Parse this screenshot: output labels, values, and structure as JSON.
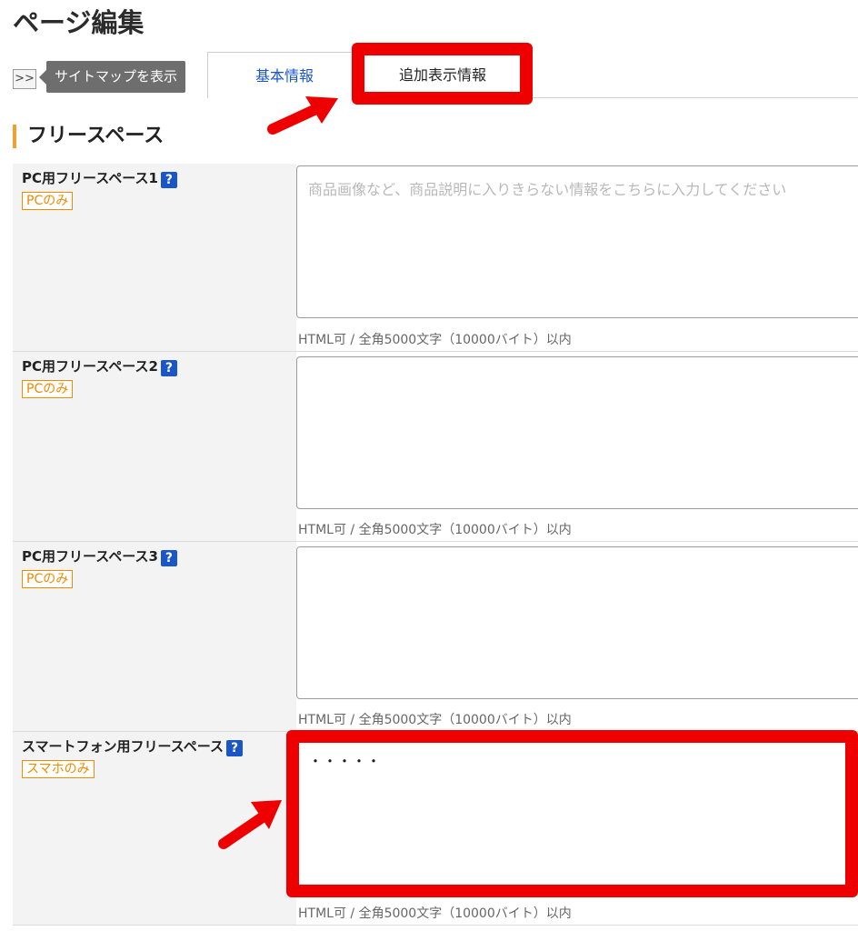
{
  "page": {
    "title": "ページ編集"
  },
  "sitemap": {
    "toggle_label": ">>",
    "tooltip": "サイトマップを表示"
  },
  "tabs": [
    {
      "label": "基本情報",
      "active": false
    },
    {
      "label": "追加表示情報",
      "active": true
    }
  ],
  "section": {
    "title": "フリースペース"
  },
  "fields": [
    {
      "label": "PC用フリースペース1",
      "badge": "PCのみ",
      "help": "?",
      "value": "",
      "placeholder": "商品画像など、商品説明に入りきらない情報をこちらに入力してください",
      "hint": "HTML可 / 全角5000文字（10000バイト）以内"
    },
    {
      "label": "PC用フリースペース2",
      "badge": "PCのみ",
      "help": "?",
      "value": "",
      "placeholder": "",
      "hint": "HTML可 / 全角5000文字（10000バイト）以内"
    },
    {
      "label": "PC用フリースペース3",
      "badge": "PCのみ",
      "help": "?",
      "value": "",
      "placeholder": "",
      "hint": "HTML可 / 全角5000文字（10000バイト）以内"
    },
    {
      "label": "スマートフォン用フリースペース",
      "badge": "スマホのみ",
      "help": "?",
      "value": "・・・・・",
      "placeholder": "",
      "hint": "HTML可 / 全角5000文字（10000バイト）以内"
    }
  ],
  "colors": {
    "highlight": "#ee0000",
    "accent": "#1a56c8",
    "badge": "#f08a00",
    "section_bar": "#f0a030"
  }
}
